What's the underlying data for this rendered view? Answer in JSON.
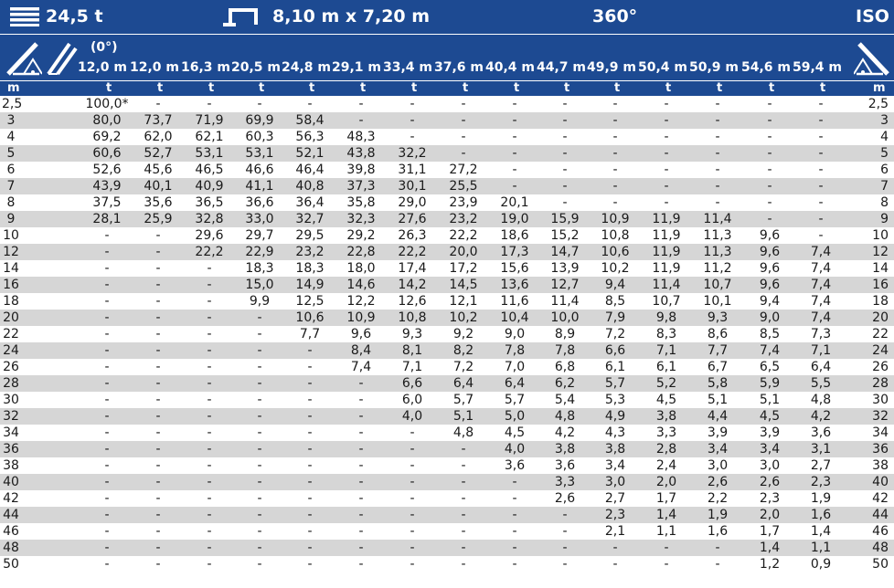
{
  "header": {
    "weight": "24,5 t",
    "outrigger": "8,10 m x 7,20 m",
    "slew": "360°",
    "standard": "ISO",
    "boom_angle": "(0°)",
    "weight_icon": "counterweight-icon",
    "outrigger_icon": "outrigger-base-icon",
    "crane_icon": "telescopic-boom-icon",
    "jib_icon": "luffing-jib-icon",
    "colors": {
      "header_bg": "#1d4a92",
      "row_shade": "#d6d6d6",
      "text": "#1a1a1a"
    }
  },
  "units": {
    "radius": "m",
    "load": "t"
  },
  "booms": [
    "12,0 m",
    "12,0 m",
    "16,3 m",
    "20,5 m",
    "24,8 m",
    "29,1 m",
    "33,4 m",
    "37,6 m",
    "40,4 m",
    "44,7 m",
    "49,9 m",
    "50,4 m",
    "50,9 m",
    "54,6 m",
    "59,4 m"
  ],
  "rows": [
    {
      "r": "2,5",
      "v": [
        "100,0*",
        "-",
        "-",
        "-",
        "-",
        "-",
        "-",
        "-",
        "-",
        "-",
        "-",
        "-",
        "-",
        "-",
        "-"
      ]
    },
    {
      "r": "3",
      "v": [
        "80,0",
        "73,7",
        "71,9",
        "69,9",
        "58,4",
        "-",
        "-",
        "-",
        "-",
        "-",
        "-",
        "-",
        "-",
        "-",
        "-"
      ]
    },
    {
      "r": "4",
      "v": [
        "69,2",
        "62,0",
        "62,1",
        "60,3",
        "56,3",
        "48,3",
        "-",
        "-",
        "-",
        "-",
        "-",
        "-",
        "-",
        "-",
        "-"
      ]
    },
    {
      "r": "5",
      "v": [
        "60,6",
        "52,7",
        "53,1",
        "53,1",
        "52,1",
        "43,8",
        "32,2",
        "-",
        "-",
        "-",
        "-",
        "-",
        "-",
        "-",
        "-"
      ]
    },
    {
      "r": "6",
      "v": [
        "52,6",
        "45,6",
        "46,5",
        "46,6",
        "46,4",
        "39,8",
        "31,1",
        "27,2",
        "-",
        "-",
        "-",
        "-",
        "-",
        "-",
        "-"
      ]
    },
    {
      "r": "7",
      "v": [
        "43,9",
        "40,1",
        "40,9",
        "41,1",
        "40,8",
        "37,3",
        "30,1",
        "25,5",
        "-",
        "-",
        "-",
        "-",
        "-",
        "-",
        "-"
      ]
    },
    {
      "r": "8",
      "v": [
        "37,5",
        "35,6",
        "36,5",
        "36,6",
        "36,4",
        "35,8",
        "29,0",
        "23,9",
        "20,1",
        "-",
        "-",
        "-",
        "-",
        "-",
        "-"
      ]
    },
    {
      "r": "9",
      "v": [
        "28,1",
        "25,9",
        "32,8",
        "33,0",
        "32,7",
        "32,3",
        "27,6",
        "23,2",
        "19,0",
        "15,9",
        "10,9",
        "11,9",
        "11,4",
        "-",
        "-"
      ]
    },
    {
      "r": "10",
      "v": [
        "-",
        "-",
        "29,6",
        "29,7",
        "29,5",
        "29,2",
        "26,3",
        "22,2",
        "18,6",
        "15,2",
        "10,8",
        "11,9",
        "11,3",
        "9,6",
        "-"
      ]
    },
    {
      "r": "12",
      "v": [
        "-",
        "-",
        "22,2",
        "22,9",
        "23,2",
        "22,8",
        "22,2",
        "20,0",
        "17,3",
        "14,7",
        "10,6",
        "11,9",
        "11,3",
        "9,6",
        "7,4"
      ]
    },
    {
      "r": "14",
      "v": [
        "-",
        "-",
        "-",
        "18,3",
        "18,3",
        "18,0",
        "17,4",
        "17,2",
        "15,6",
        "13,9",
        "10,2",
        "11,9",
        "11,2",
        "9,6",
        "7,4"
      ]
    },
    {
      "r": "16",
      "v": [
        "-",
        "-",
        "-",
        "15,0",
        "14,9",
        "14,6",
        "14,2",
        "14,5",
        "13,6",
        "12,7",
        "9,4",
        "11,4",
        "10,7",
        "9,6",
        "7,4"
      ]
    },
    {
      "r": "18",
      "v": [
        "-",
        "-",
        "-",
        "9,9",
        "12,5",
        "12,2",
        "12,6",
        "12,1",
        "11,6",
        "11,4",
        "8,5",
        "10,7",
        "10,1",
        "9,4",
        "7,4"
      ]
    },
    {
      "r": "20",
      "v": [
        "-",
        "-",
        "-",
        "-",
        "10,6",
        "10,9",
        "10,8",
        "10,2",
        "10,4",
        "10,0",
        "7,9",
        "9,8",
        "9,3",
        "9,0",
        "7,4"
      ]
    },
    {
      "r": "22",
      "v": [
        "-",
        "-",
        "-",
        "-",
        "7,7",
        "9,6",
        "9,3",
        "9,2",
        "9,0",
        "8,9",
        "7,2",
        "8,3",
        "8,6",
        "8,5",
        "7,3"
      ]
    },
    {
      "r": "24",
      "v": [
        "-",
        "-",
        "-",
        "-",
        "-",
        "8,4",
        "8,1",
        "8,2",
        "7,8",
        "7,8",
        "6,6",
        "7,1",
        "7,7",
        "7,4",
        "7,1"
      ]
    },
    {
      "r": "26",
      "v": [
        "-",
        "-",
        "-",
        "-",
        "-",
        "7,4",
        "7,1",
        "7,2",
        "7,0",
        "6,8",
        "6,1",
        "6,1",
        "6,7",
        "6,5",
        "6,4"
      ]
    },
    {
      "r": "28",
      "v": [
        "-",
        "-",
        "-",
        "-",
        "-",
        "-",
        "6,6",
        "6,4",
        "6,4",
        "6,2",
        "5,7",
        "5,2",
        "5,8",
        "5,9",
        "5,5"
      ]
    },
    {
      "r": "30",
      "v": [
        "-",
        "-",
        "-",
        "-",
        "-",
        "-",
        "6,0",
        "5,7",
        "5,7",
        "5,4",
        "5,3",
        "4,5",
        "5,1",
        "5,1",
        "4,8"
      ]
    },
    {
      "r": "32",
      "v": [
        "-",
        "-",
        "-",
        "-",
        "-",
        "-",
        "4,0",
        "5,1",
        "5,0",
        "4,8",
        "4,9",
        "3,8",
        "4,4",
        "4,5",
        "4,2"
      ]
    },
    {
      "r": "34",
      "v": [
        "-",
        "-",
        "-",
        "-",
        "-",
        "-",
        "-",
        "4,8",
        "4,5",
        "4,2",
        "4,3",
        "3,3",
        "3,9",
        "3,9",
        "3,6"
      ]
    },
    {
      "r": "36",
      "v": [
        "-",
        "-",
        "-",
        "-",
        "-",
        "-",
        "-",
        "-",
        "4,0",
        "3,8",
        "3,8",
        "2,8",
        "3,4",
        "3,4",
        "3,1"
      ]
    },
    {
      "r": "38",
      "v": [
        "-",
        "-",
        "-",
        "-",
        "-",
        "-",
        "-",
        "-",
        "3,6",
        "3,6",
        "3,4",
        "2,4",
        "3,0",
        "3,0",
        "2,7"
      ]
    },
    {
      "r": "40",
      "v": [
        "-",
        "-",
        "-",
        "-",
        "-",
        "-",
        "-",
        "-",
        "-",
        "3,3",
        "3,0",
        "2,0",
        "2,6",
        "2,6",
        "2,3"
      ]
    },
    {
      "r": "42",
      "v": [
        "-",
        "-",
        "-",
        "-",
        "-",
        "-",
        "-",
        "-",
        "-",
        "2,6",
        "2,7",
        "1,7",
        "2,2",
        "2,3",
        "1,9"
      ]
    },
    {
      "r": "44",
      "v": [
        "-",
        "-",
        "-",
        "-",
        "-",
        "-",
        "-",
        "-",
        "-",
        "-",
        "2,3",
        "1,4",
        "1,9",
        "2,0",
        "1,6"
      ]
    },
    {
      "r": "46",
      "v": [
        "-",
        "-",
        "-",
        "-",
        "-",
        "-",
        "-",
        "-",
        "-",
        "-",
        "2,1",
        "1,1",
        "1,6",
        "1,7",
        "1,4"
      ]
    },
    {
      "r": "48",
      "v": [
        "-",
        "-",
        "-",
        "-",
        "-",
        "-",
        "-",
        "-",
        "-",
        "-",
        "-",
        "-",
        "-",
        "1,4",
        "1,1"
      ]
    },
    {
      "r": "50",
      "v": [
        "-",
        "-",
        "-",
        "-",
        "-",
        "-",
        "-",
        "-",
        "-",
        "-",
        "-",
        "-",
        "-",
        "1,2",
        "0,9"
      ]
    }
  ]
}
